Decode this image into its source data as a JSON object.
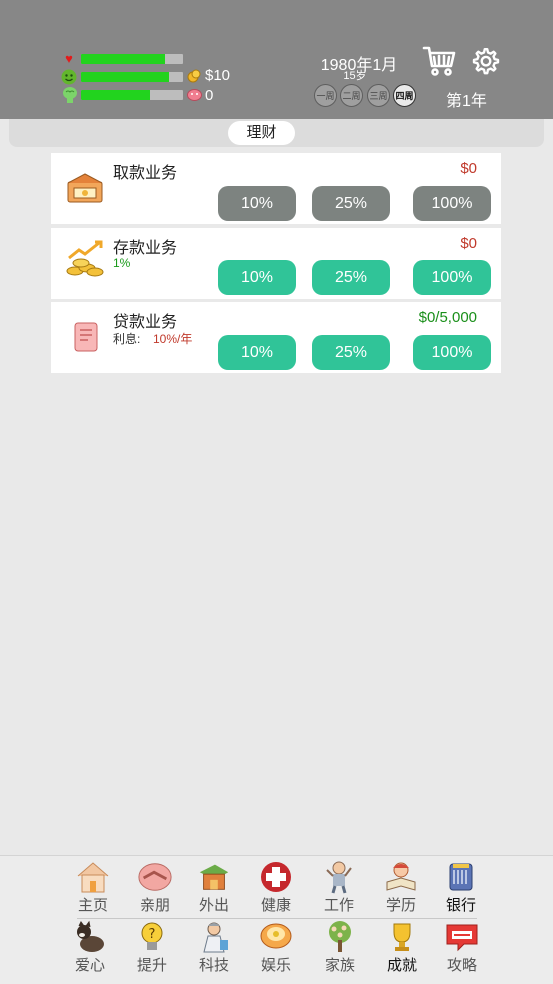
{
  "stats": {
    "health": {
      "icon": "heart-icon",
      "level": 0.82
    },
    "mood": {
      "icon": "smiley-icon",
      "level": 0.86
    },
    "smarts": {
      "icon": "brain-icon",
      "level": 0.68
    }
  },
  "money": {
    "cash_icon": "coin-icon",
    "cash": "$10",
    "debt_icon": "pig-icon",
    "debt": "0"
  },
  "date": {
    "date_text": "1980年1月",
    "age": "15岁"
  },
  "weeks": [
    {
      "label": "一周",
      "active": false
    },
    {
      "label": "二周",
      "active": false
    },
    {
      "label": "三周",
      "active": false
    },
    {
      "label": "四周",
      "active": true
    }
  ],
  "year_label": "第1年",
  "header_icons": {
    "cart": "cart-icon",
    "settings": "gear-icon"
  },
  "tab": {
    "label": "理财"
  },
  "cards": [
    {
      "title": "取款业务",
      "sub": "",
      "amount": "$0",
      "amount_color": "#c0392b",
      "buttons": [
        "10%",
        "25%",
        "100%"
      ],
      "style": "grey",
      "icon": "house-money-icon"
    },
    {
      "title": "存款业务",
      "sub": "1%",
      "amount": "$0",
      "amount_color": "#c0392b",
      "buttons": [
        "10%",
        "25%",
        "100%"
      ],
      "style": "green",
      "icon": "coins-growth-icon"
    },
    {
      "title": "贷款业务",
      "sub_label": "利息:",
      "sub": "10%/年",
      "amount": "$0/5,000",
      "amount_color": "#1a8f1a",
      "buttons": [
        "10%",
        "25%",
        "100%"
      ],
      "style": "green",
      "icon": "loan-note-icon"
    }
  ],
  "nav_row1": [
    {
      "label": "主页",
      "icon": "home-icon",
      "active": false
    },
    {
      "label": "亲朋",
      "icon": "handshake-icon",
      "active": false
    },
    {
      "label": "外出",
      "icon": "travel-icon",
      "active": false
    },
    {
      "label": "健康",
      "icon": "medical-cross-icon",
      "active": false
    },
    {
      "label": "工作",
      "icon": "worker-icon",
      "active": false
    },
    {
      "label": "学历",
      "icon": "study-icon",
      "active": false
    },
    {
      "label": "银行",
      "icon": "bank-icon",
      "active": true
    }
  ],
  "nav_row2": [
    {
      "label": "爱心",
      "icon": "dog-icon",
      "active": false
    },
    {
      "label": "提升",
      "icon": "lightbulb-icon",
      "active": false
    },
    {
      "label": "科技",
      "icon": "scientist-icon",
      "active": false
    },
    {
      "label": "娱乐",
      "icon": "entertainment-icon",
      "active": false
    },
    {
      "label": "家族",
      "icon": "family-tree-icon",
      "active": false
    },
    {
      "label": "成就",
      "icon": "trophy-icon",
      "active": true
    },
    {
      "label": "攻略",
      "icon": "tips-icon",
      "active": false
    }
  ]
}
